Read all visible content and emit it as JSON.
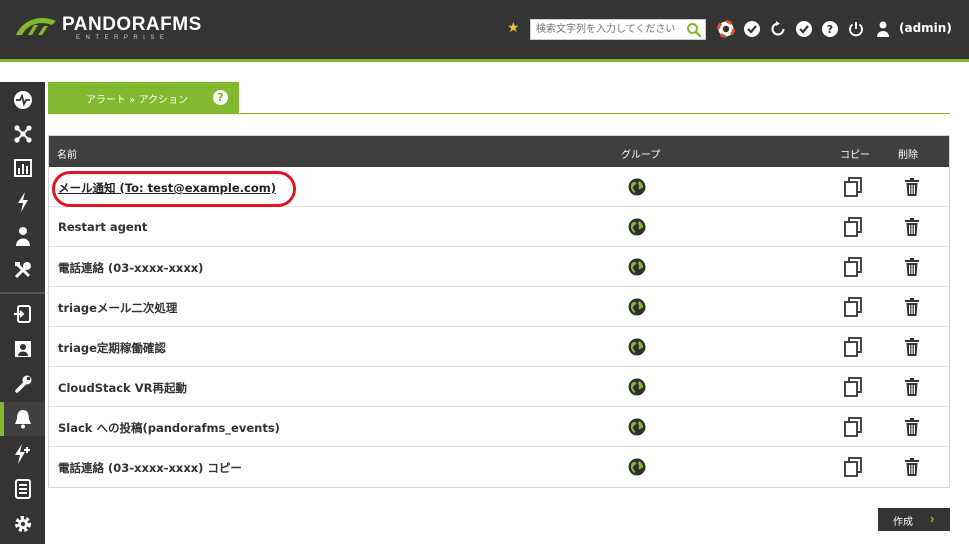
{
  "header": {
    "logo_text": "PANDORAFMS",
    "logo_sub": "ENTERPRISE",
    "search_placeholder": "検索文字列を入力してください",
    "user_label": "(admin)"
  },
  "breadcrumb": {
    "text": "アラート » アクション",
    "help_label": "?"
  },
  "table": {
    "headers": {
      "name": "名前",
      "group": "グループ",
      "copy": "コピー",
      "delete": "削除"
    },
    "rows": [
      {
        "name": "メール通知 (To: test@example.com)"
      },
      {
        "name": "Restart agent"
      },
      {
        "name": "電話連絡 (03-xxxx-xxxx)"
      },
      {
        "name": "triageメール二次処理"
      },
      {
        "name": "triage定期稼働確認"
      },
      {
        "name": "CloudStack VR再起動"
      },
      {
        "name": "Slack への投稿(pandorafms_events)"
      },
      {
        "name": "電話連絡 (03-xxxx-xxxx) コピー"
      }
    ]
  },
  "actions": {
    "create_label": "作成"
  },
  "colors": {
    "accent": "#82b92e",
    "dark": "#343434",
    "highlight": "#e0141e"
  }
}
